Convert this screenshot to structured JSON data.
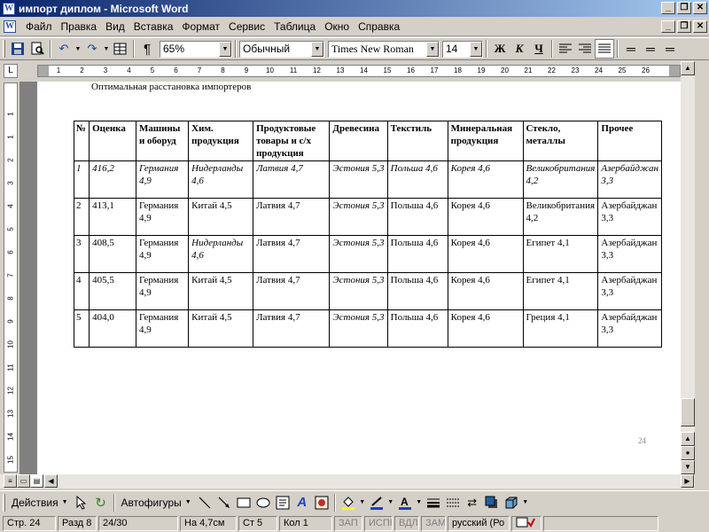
{
  "window": {
    "title": "импорт диплом - Microsoft Word",
    "app_icon": "W"
  },
  "menu": [
    "Файл",
    "Правка",
    "Вид",
    "Вставка",
    "Формат",
    "Сервис",
    "Таблица",
    "Окно",
    "Справка"
  ],
  "toolbar": {
    "zoom": "65%",
    "style": "Обычный",
    "font": "Times New Roman",
    "size": "14",
    "bold": "Ж",
    "italic": "К",
    "underline": "Ч"
  },
  "ruler": {
    "h_numbers": [
      "1",
      "2",
      "3",
      "4",
      "5",
      "6",
      "7",
      "8",
      "9",
      "10",
      "11",
      "12",
      "13",
      "14",
      "15",
      "16",
      "17",
      "18",
      "19",
      "20",
      "21",
      "22",
      "23",
      "24",
      "25",
      "26"
    ],
    "v_numbers": [
      "1",
      "1",
      "2",
      "3",
      "4",
      "5",
      "6",
      "7",
      "8",
      "9",
      "10",
      "11",
      "12",
      "13",
      "14",
      "15",
      "16"
    ]
  },
  "document": {
    "caption": "Оптимальная расстановка импортеров",
    "page_number": "24",
    "table": {
      "headers": [
        "№",
        "Оценка",
        "Машины и оборуд",
        "Хим. продукция",
        "Продуктовые товары и с/х продукция",
        "Древесина",
        "Текстиль",
        "Минеральная продукция",
        "Стекло, металлы",
        "Прочее"
      ],
      "rows": [
        {
          "italic": [
            true,
            true,
            true,
            true,
            true,
            true,
            true,
            true,
            true,
            true
          ],
          "cells": [
            "1",
            "416,2",
            "Германия 4,9",
            "Нидерланды 4,6",
            "Латвия 4,7",
            "Эстония 5,3",
            "Польша 4,6",
            "Корея 4,6",
            "Великобритания 4,2",
            "Азербайджан 3,3"
          ]
        },
        {
          "italic": [
            false,
            false,
            false,
            false,
            false,
            true,
            false,
            false,
            false,
            false
          ],
          "cells": [
            "2",
            "413,1",
            "Германия 4,9",
            "Китай 4,5",
            "Латвия 4,7",
            "Эстония 5,3",
            "Польша 4,6",
            "Корея 4,6",
            "Великобритания 4,2",
            "Азербайджан 3,3"
          ]
        },
        {
          "italic": [
            false,
            false,
            false,
            true,
            false,
            true,
            false,
            false,
            false,
            false
          ],
          "cells": [
            "3",
            "408,5",
            "Германия 4,9",
            "Нидерланды 4,6",
            "Латвия 4,7",
            "Эстония 5,3",
            "Польша 4,6",
            "Корея 4,6",
            "Египет 4,1",
            "Азербайджан 3,3"
          ]
        },
        {
          "italic": [
            false,
            false,
            false,
            false,
            false,
            true,
            false,
            false,
            false,
            false
          ],
          "cells": [
            "4",
            "405,5",
            "Германия 4,9",
            "Китай 4,5",
            "Латвия 4,7",
            "Эстония 5,3",
            "Польша 4,6",
            "Корея 4,6",
            "Египет 4,1",
            "Азербайджан 3,3"
          ]
        },
        {
          "italic": [
            false,
            false,
            false,
            false,
            false,
            true,
            false,
            false,
            false,
            false
          ],
          "cells": [
            "5",
            "404,0",
            "Германия 4,9",
            "Китай 4,5",
            "Латвия 4,7",
            "Эстония 5,3",
            "Польша 4,6",
            "Корея 4,6",
            "Греция 4,1",
            "Азербайджан 3,3"
          ]
        }
      ]
    }
  },
  "drawing": {
    "actions": "Действия",
    "autoshapes": "Автофигуры"
  },
  "status": {
    "page": "Стр. 24",
    "section": "Разд 8",
    "pages": "24/30",
    "at": "На 4,7см",
    "line": "Ст 5",
    "col": "Кол 1",
    "rec": "ЗАП",
    "trk": "ИСПР",
    "ext": "ВДЛ",
    "ovr": "ЗАМ",
    "lang": "русский (Ро"
  },
  "icons": [
    "word-icon",
    "minimize-icon",
    "restore-icon",
    "close-icon",
    "save-icon",
    "print-preview-icon",
    "undo-icon",
    "redo-icon",
    "table-icon",
    "pilcrow-icon",
    "align-left-icon",
    "align-right-icon",
    "justify-icon",
    "cursor-icon",
    "rotate-icon",
    "line-icon",
    "arrow-icon",
    "rectangle-icon",
    "oval-icon",
    "textbox-icon",
    "wordart-icon",
    "clipart-icon",
    "fill-color-icon",
    "line-color-icon",
    "font-color-icon",
    "line-style-icon",
    "dash-style-icon",
    "arrow-style-icon",
    "shadow-icon",
    "3d-icon"
  ],
  "colors": {
    "title_gradient_start": "#0a246a",
    "title_gradient_end": "#a6caf0",
    "chrome": "#d4d0c8",
    "doc_background": "#808080"
  }
}
